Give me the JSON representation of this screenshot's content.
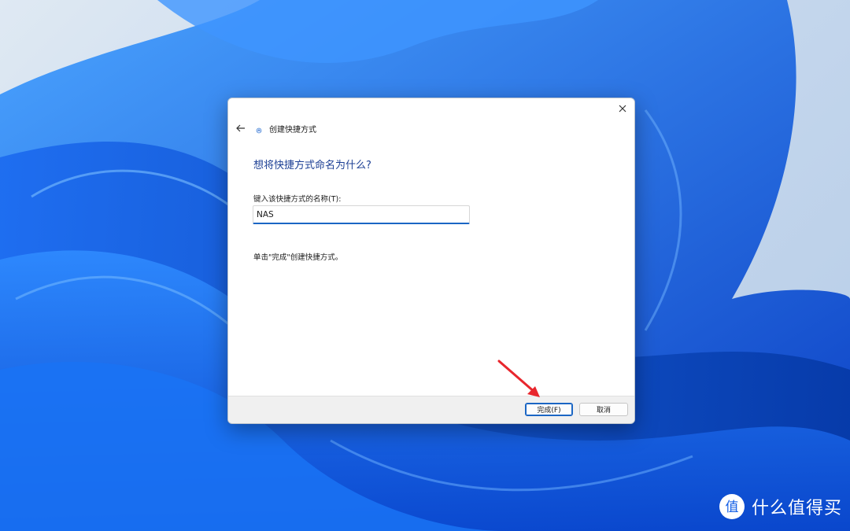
{
  "dialog": {
    "close_icon": "close-icon",
    "back_icon": "back-arrow-icon",
    "wizard_icon": "shortcut-wizard-icon",
    "title": "创建快捷方式",
    "heading": "想将快捷方式命名为什么?",
    "field_label": "键入该快捷方式的名称(T):",
    "name_value": "NAS",
    "hint": "单击\"完成\"创建快捷方式。",
    "finish_label": "完成(F)",
    "cancel_label": "取消"
  },
  "annotation": {
    "arrow_color": "#e8262d",
    "arrow_icon": "red-arrow-annotation"
  },
  "watermark": {
    "logo_icon": "zhi-logo-icon",
    "text": "什么值得买"
  },
  "colors": {
    "accent": "#1b66c4",
    "heading": "#1c3f94",
    "wallpaper_blue": "#1560e6"
  }
}
